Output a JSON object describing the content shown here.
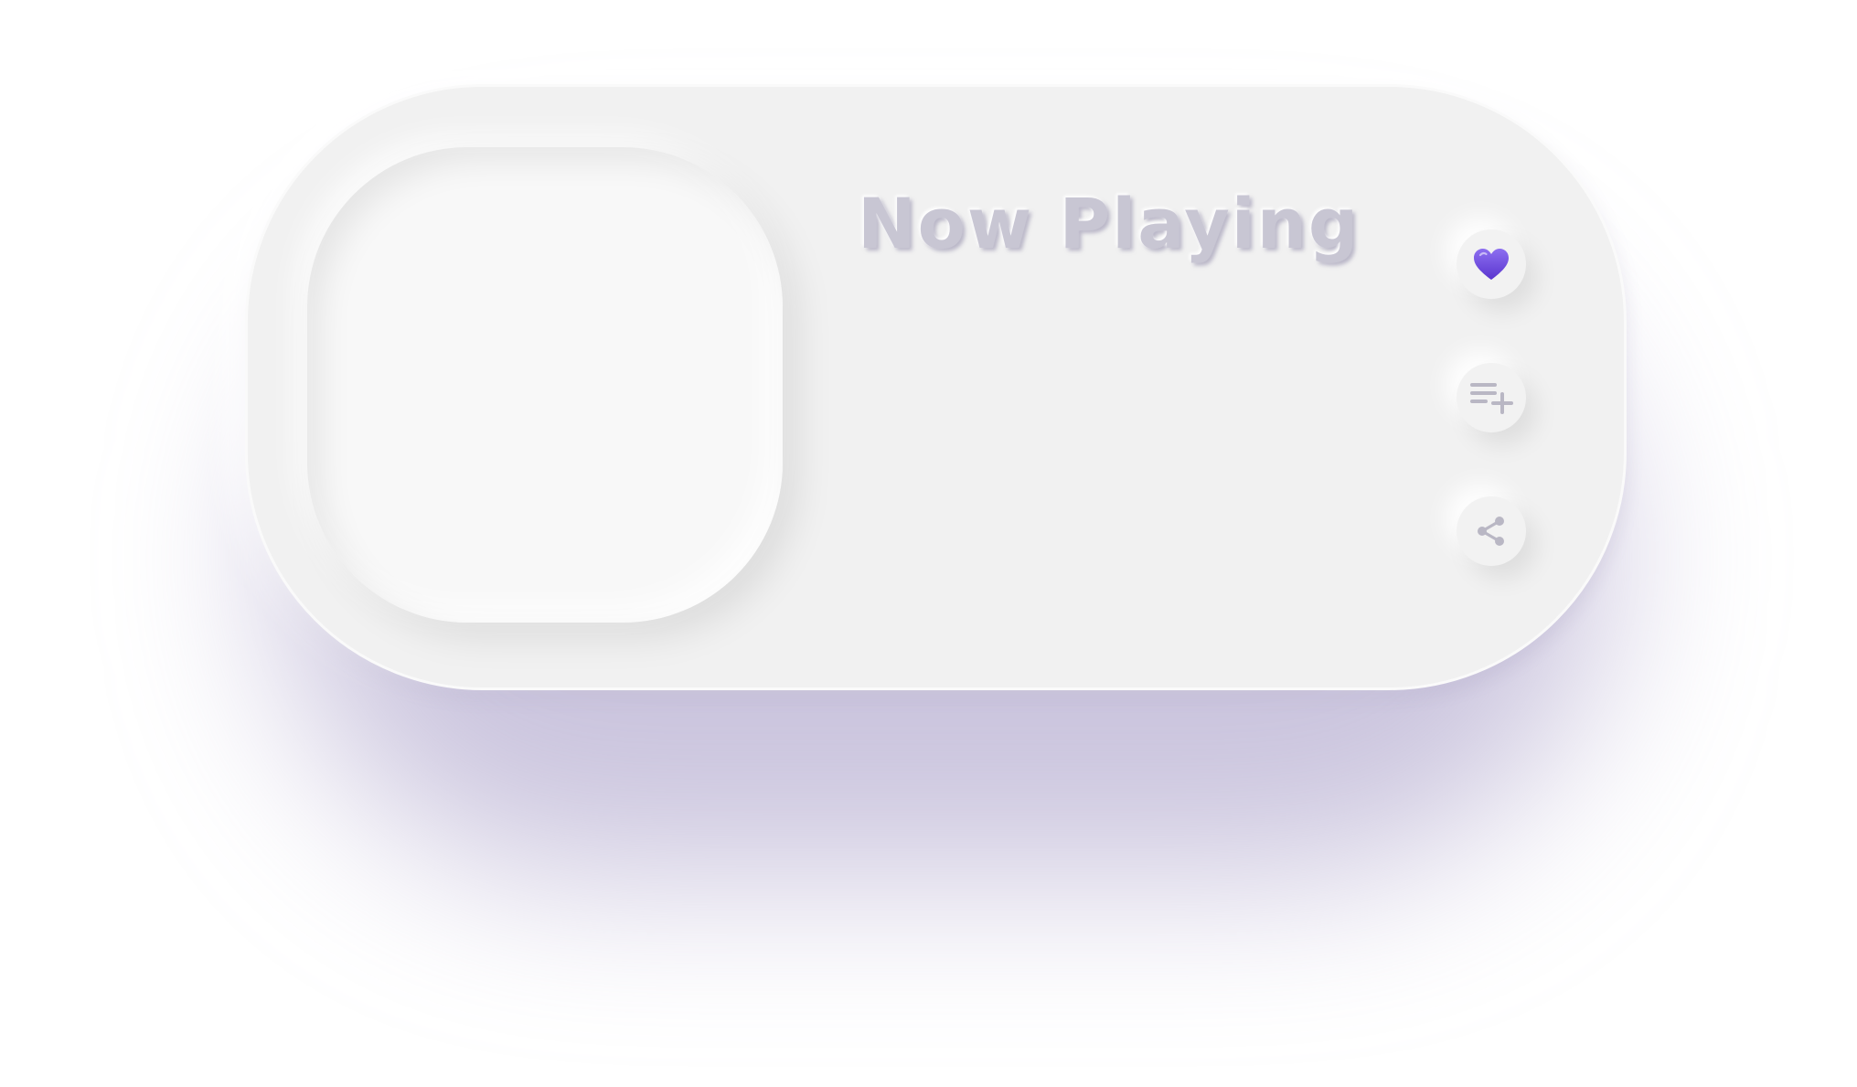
{
  "player": {
    "heading": "Now Playing",
    "colors": {
      "card_background": "#f1f1f1",
      "title_color": "#c8c6d3",
      "heart_gradient_top": "#8d6ff0",
      "heart_gradient_bottom": "#5a35cf",
      "icon_gray": "#b9b7c4",
      "shadow_tint": "#a096c3"
    },
    "actions": [
      {
        "icon": "heart-icon",
        "state": "active"
      },
      {
        "icon": "playlist-add-icon"
      },
      {
        "icon": "share-icon"
      }
    ]
  }
}
